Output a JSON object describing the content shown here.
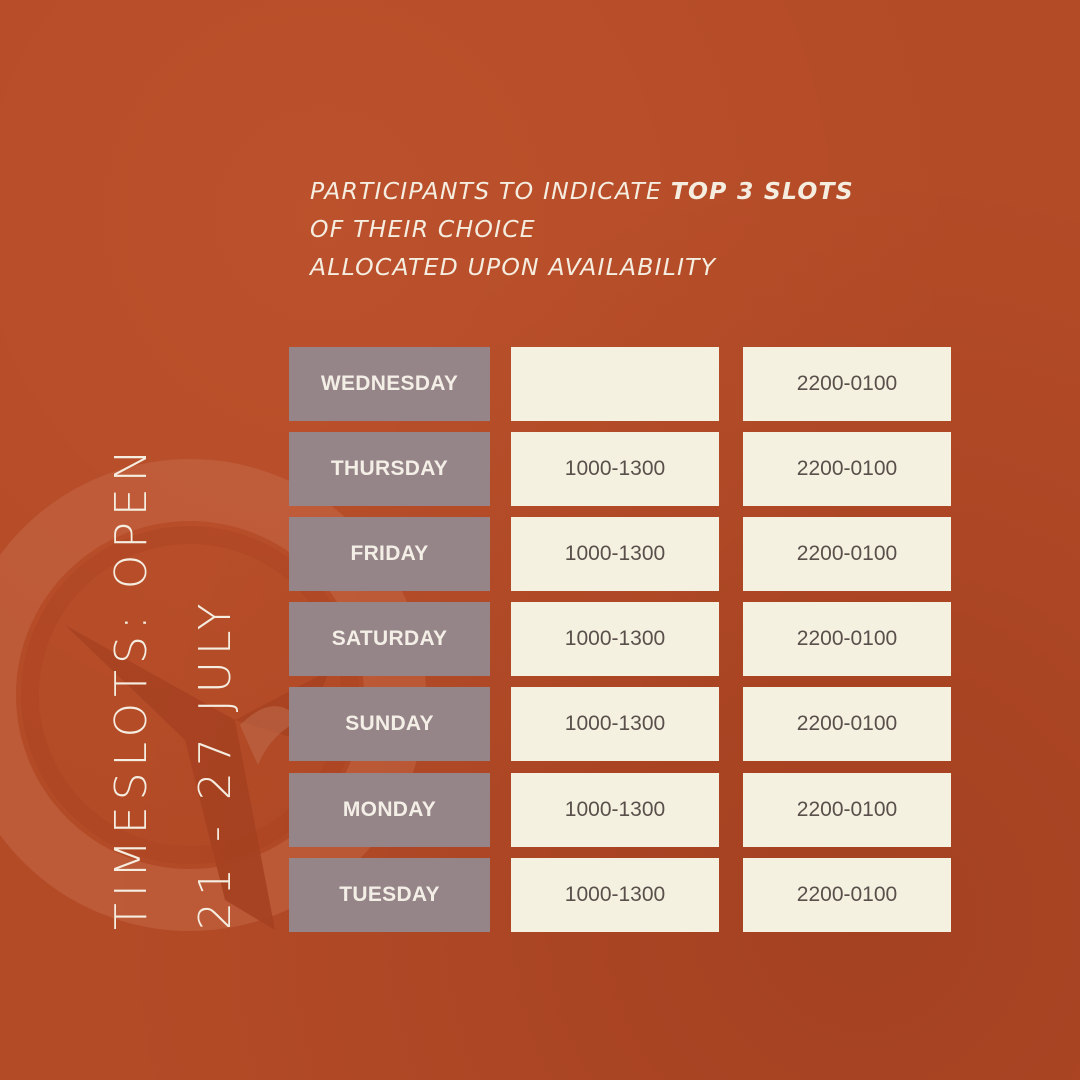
{
  "headline": {
    "line1_prefix": "PARTICIPANTS TO INDICATE ",
    "line1_emphasis": "TOP 3 SLOTS",
    "line2": "OF THEIR CHOICE",
    "line3": "ALLOCATED UPON AVAILABILITY"
  },
  "side_title": {
    "line1": "TIMESLOTS: OPEN",
    "line2": "21 - 27 JULY"
  },
  "schedule": [
    {
      "day": "WEDNESDAY",
      "slot1": "",
      "slot2": "2200-0100"
    },
    {
      "day": "THURSDAY",
      "slot1": "1000-1300",
      "slot2": "2200-0100"
    },
    {
      "day": "FRIDAY",
      "slot1": "1000-1300",
      "slot2": "2200-0100"
    },
    {
      "day": "SATURDAY",
      "slot1": "1000-1300",
      "slot2": "2200-0100"
    },
    {
      "day": "SUNDAY",
      "slot1": "1000-1300",
      "slot2": "2200-0100"
    },
    {
      "day": "MONDAY",
      "slot1": "1000-1300",
      "slot2": "2200-0100"
    },
    {
      "day": "TUESDAY",
      "slot1": "1000-1300",
      "slot2": "2200-0100"
    }
  ],
  "colors": {
    "background": "#b44b27",
    "day_cell": "#958488",
    "slot_cell": "#f5f1e1",
    "headline_text": "#f4ede0",
    "slot_text": "#5a504b"
  },
  "icons": [
    "logo-watermark-icon"
  ]
}
